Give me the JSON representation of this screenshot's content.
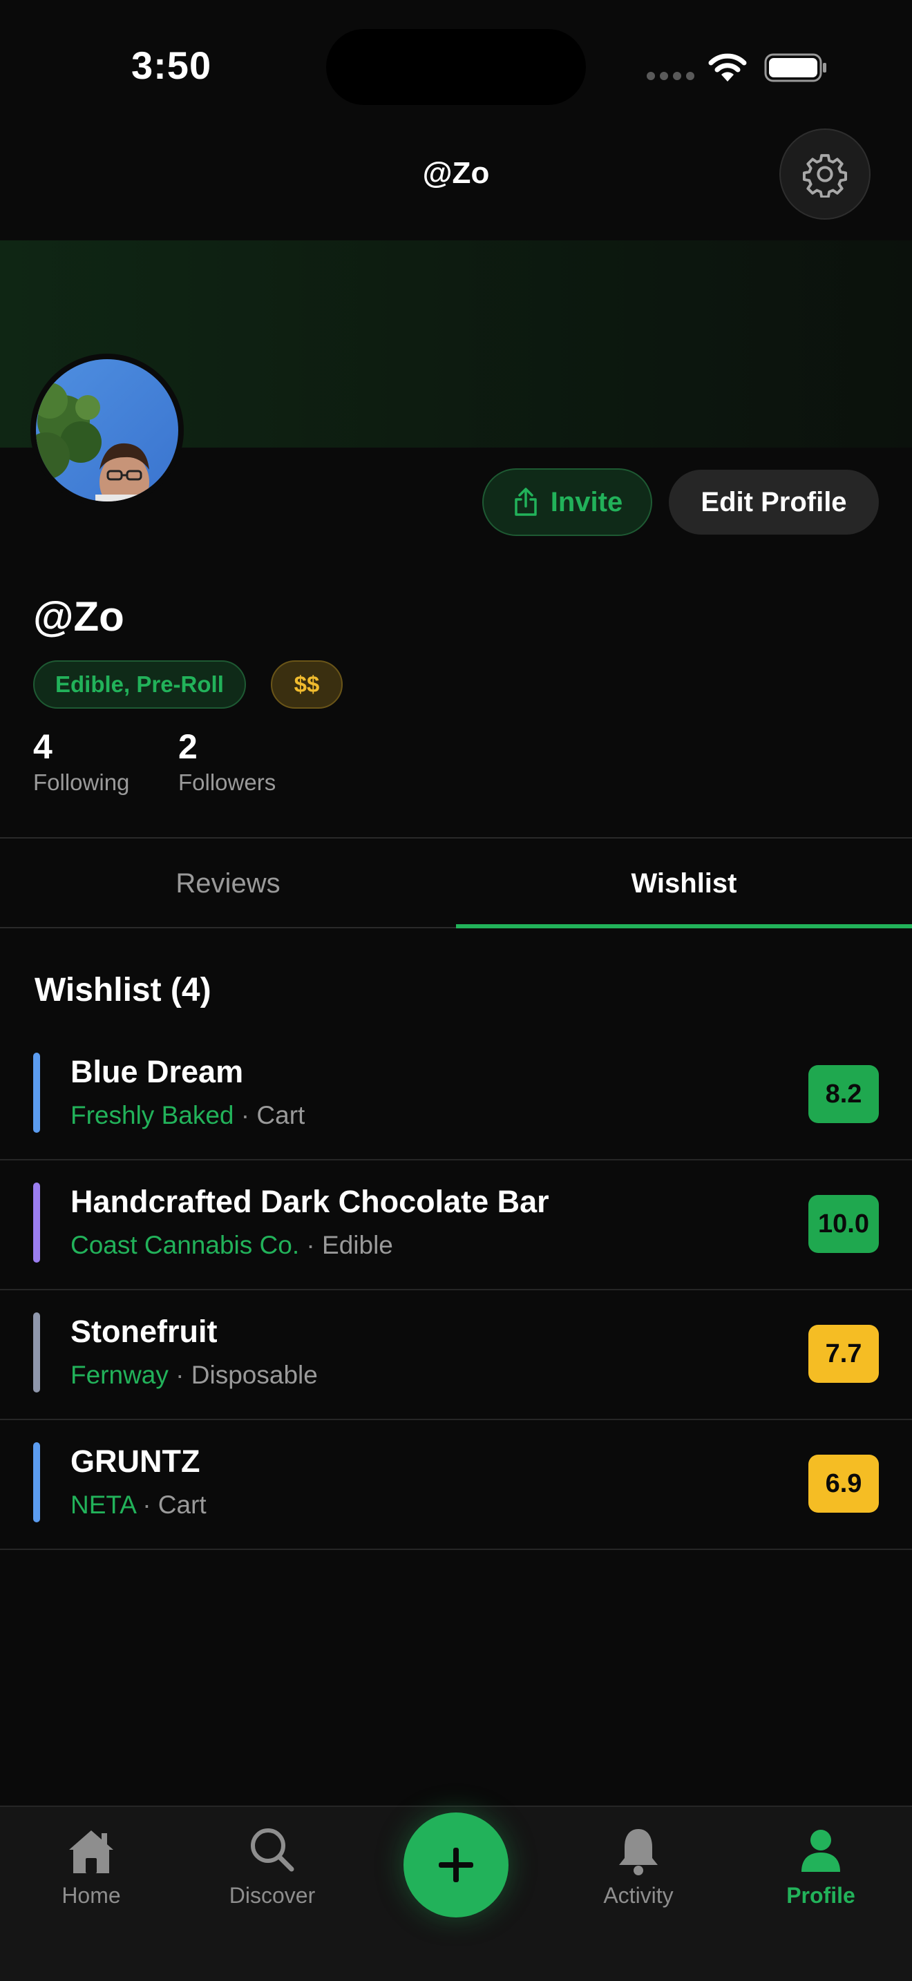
{
  "status_bar": {
    "time": "3:50"
  },
  "header": {
    "title": "@Zo"
  },
  "profile": {
    "invite_label": "Invite",
    "edit_label": "Edit Profile",
    "username": "@Zo",
    "preference_tag": "Edible, Pre-Roll",
    "price_tag": "$$",
    "following_count": "4",
    "following_label": "Following",
    "followers_count": "2",
    "followers_label": "Followers"
  },
  "tabs": [
    {
      "label": "Reviews",
      "active": false
    },
    {
      "label": "Wishlist",
      "active": true
    }
  ],
  "wishlist": {
    "title": "Wishlist (4)",
    "items": [
      {
        "name": "Blue Dream",
        "brand": "Freshly Baked",
        "separator": "·",
        "type": "Cart",
        "score": "8.2",
        "accent": "#5b9cf0",
        "score_color": "#1fa84f"
      },
      {
        "name": "Handcrafted Dark Chocolate Bar",
        "brand": "Coast Cannabis Co.",
        "separator": "·",
        "type": "Edible",
        "score": "10.0",
        "accent": "#9b7ef0",
        "score_color": "#1fa84f"
      },
      {
        "name": "Stonefruit",
        "brand": "Fernway",
        "separator": "·",
        "type": "Disposable",
        "score": "7.7",
        "accent": "#8f97ab",
        "score_color": "#f5bd24"
      },
      {
        "name": "GRUNTZ",
        "brand": "NETA",
        "separator": "·",
        "type": "Cart",
        "score": "6.9",
        "accent": "#5b9cf0",
        "score_color": "#f5bd24"
      }
    ]
  },
  "tab_bar": {
    "items": [
      {
        "label": "Home",
        "icon": "home-icon",
        "active": false
      },
      {
        "label": "Discover",
        "icon": "search-icon",
        "active": false
      },
      {
        "label": "Activity",
        "icon": "bell-icon",
        "active": false
      },
      {
        "label": "Profile",
        "icon": "person-icon",
        "active": true
      }
    ],
    "add_icon": "plus-icon"
  },
  "colors": {
    "accent": "#22b25a",
    "background": "#0a0a0a",
    "gold": "#f0bb2e"
  }
}
